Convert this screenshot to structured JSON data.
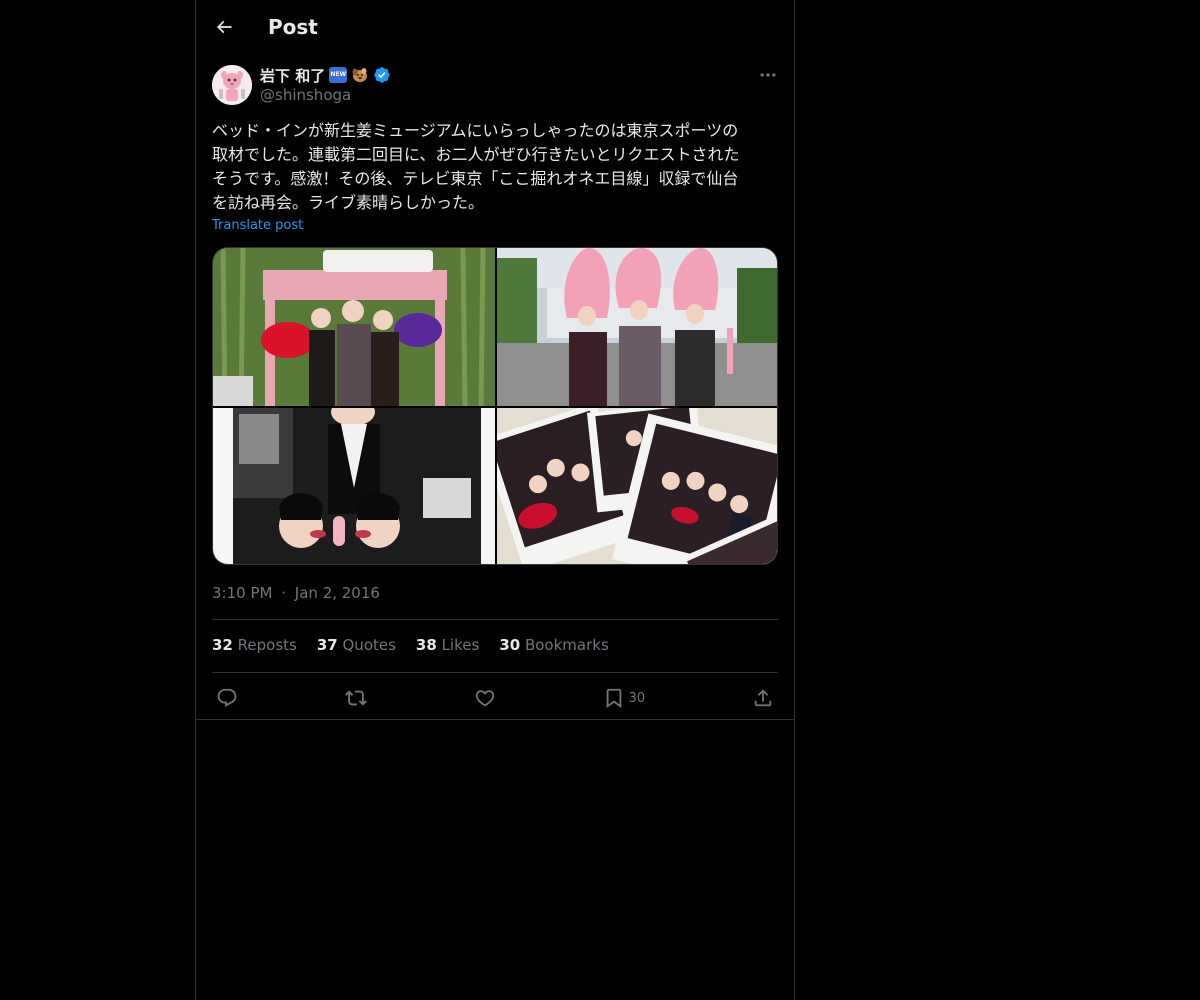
{
  "header": {
    "title": "Post",
    "back_icon": "arrow-left-icon"
  },
  "author": {
    "display_name": "岩下 和了",
    "new_emoji": "NEW",
    "handle": "@shinshoga",
    "verified": true,
    "verified_color": "#1d9bf0"
  },
  "post": {
    "text": "ベッド・インが新生姜ミュージアムにいらっしゃったのは東京スポーツの\n取材でした。連載第二回目に、お二人がぜひ行きたいとリクエストされた\nそうです。感激！その後、テレビ東京「ここ掘れオネエ目線」収録で仙台\nを訪ね再会。ライブ素晴らしかった。",
    "translate_label": "Translate post",
    "time": "3:10 PM",
    "separator": "·",
    "date": "Jan 2, 2016"
  },
  "stats": [
    {
      "count": "32",
      "label": "Reposts"
    },
    {
      "count": "37",
      "label": "Quotes"
    },
    {
      "count": "38",
      "label": "Likes"
    },
    {
      "count": "30",
      "label": "Bookmarks"
    }
  ],
  "actions": {
    "reply_icon": "reply-icon",
    "repost_icon": "repost-icon",
    "like_icon": "heart-icon",
    "bookmark_icon": "bookmark-icon",
    "bookmark_count": "30",
    "share_icon": "share-icon"
  },
  "colors": {
    "accent": "#1d9bf0",
    "text": "#e7e9ea",
    "muted": "#71767b",
    "border": "#2f3336",
    "background": "#000000"
  }
}
